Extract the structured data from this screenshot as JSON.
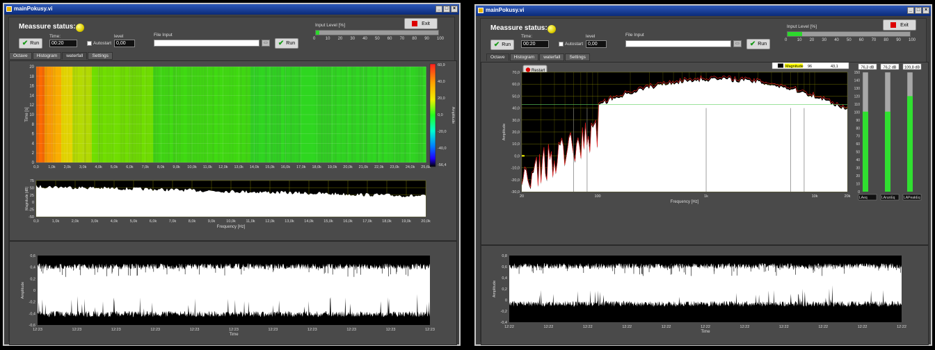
{
  "left_window": {
    "title": "mainPokusy.vi",
    "status_label": "Meassure status:",
    "run_label": "Run",
    "time_label": "Time:",
    "time_value": "00:20",
    "autostart_label": "Autostart",
    "level_label": "level",
    "level_value": "0,00",
    "file_input_label": "File Input",
    "file_input_value": "",
    "run2_label": "Run",
    "input_level_label": "Input Level [%]",
    "input_level_ticks": [
      "0",
      "10",
      "20",
      "30",
      "40",
      "50",
      "60",
      "70",
      "80",
      "90",
      "100"
    ],
    "input_level_percent": 3,
    "exit_label": "Exit",
    "tabs": [
      "Octave",
      "Histogram",
      "waterfall",
      "Settings"
    ],
    "active_tab": 2,
    "waterfall": {
      "y_label": "Time [s]",
      "y_ticks": [
        "20",
        "18",
        "16",
        "14",
        "12",
        "10",
        "8",
        "6",
        "4",
        "2",
        "0"
      ],
      "x_ticks": [
        "0,0",
        "1,0k",
        "2,0k",
        "3,0k",
        "4,0k",
        "5,0k",
        "6,0k",
        "7,0k",
        "8,0k",
        "9,0k",
        "10,0k",
        "11,0k",
        "12,0k",
        "13,0k",
        "14,0k",
        "15,0k",
        "16,0k",
        "17,0k",
        "18,0k",
        "19,0k",
        "20,0k",
        "21,0k",
        "22,0k",
        "23,0k",
        "24,0k",
        "25,6k"
      ],
      "colorbar_ticks": [
        "60,9",
        "40,0",
        "20,0",
        "0,0",
        "-20,0",
        "-40,0",
        "-56,4"
      ],
      "colorbar_label": "Amplitude"
    },
    "spectrum": {
      "y_label": "Magnitude [dB]",
      "y_ticks": [
        "75",
        "50",
        "25",
        "0",
        "-25",
        "-50"
      ],
      "x_ticks": [
        "0,0",
        "1,0k",
        "2,0k",
        "3,0k",
        "4,0k",
        "5,0k",
        "6,0k",
        "7,0k",
        "8,0k",
        "9,0k",
        "10,0k",
        "11,0k",
        "12,0k",
        "13,0k",
        "14,0k",
        "15,0k",
        "16,0k",
        "17,0k",
        "18,0k",
        "19,0k",
        "20,0k"
      ],
      "x_label": "Frequency [Hz]"
    },
    "time_plot": {
      "y_label": "Amplitude",
      "y_ticks": [
        "0,6",
        "0,4",
        "0,2",
        "0",
        "-0,2",
        "-0,4",
        "-0,6"
      ],
      "x_ticks": [
        "12:23",
        "12:23",
        "12:23",
        "12:23",
        "12:23",
        "12:23",
        "12:23",
        "12:23",
        "12:23",
        "12:23",
        "12:23"
      ],
      "x_label": "Time"
    }
  },
  "right_window": {
    "title": "mainPokusy.vi",
    "status_label": "Meassure status:",
    "run_label": "Run",
    "time_label": "Time:",
    "time_value": "00:20",
    "autostart_label": "Autostart",
    "level_label": "level",
    "level_value": "0,00",
    "file_input_label": "File Input",
    "file_input_value": "",
    "run2_label": "Run",
    "input_level_label": "Input Level [%]",
    "input_level_ticks": [
      "0",
      "10",
      "20",
      "30",
      "40",
      "50",
      "60",
      "70",
      "80",
      "90",
      "100"
    ],
    "input_level_percent": 12,
    "exit_label": "Exit",
    "tabs": [
      "Octave",
      "Histogram",
      "waterfall",
      "Settings"
    ],
    "active_tab": 0,
    "restart_label": "Restart",
    "legend": {
      "name": "Magnitude",
      "x": "96",
      "y": "43,1"
    },
    "octave": {
      "y_label": "Amplitude",
      "y_ticks": [
        "70,0",
        "60,0",
        "50,0",
        "40,0",
        "30,0",
        "20,0",
        "10,0",
        "0,0",
        "-10,0",
        "-20,0",
        "-30,0"
      ],
      "x_ticks": [
        "20",
        "100",
        "1k",
        "10k",
        "20k"
      ],
      "x_label": "Frequency [Hz]"
    },
    "meters": [
      {
        "value_label": "76,3 dB",
        "name": "LAeq",
        "fill_percent": 67
      },
      {
        "value_label": "76,2 dB",
        "name": "LArunEq",
        "fill_percent": 67
      },
      {
        "value_label": "109,8 dB",
        "name": "LAPeakEq",
        "fill_percent": 80
      }
    ],
    "meter_ticks": [
      "150",
      "140",
      "130",
      "120",
      "110",
      "100",
      "90",
      "80",
      "70",
      "60",
      "50",
      "40",
      "30",
      "20",
      "10",
      "0"
    ],
    "time_plot": {
      "y_label": "Amplitude",
      "y_ticks": [
        "0,8",
        "0,6",
        "0,4",
        "0,2",
        "0",
        "-0,2",
        "-0,4"
      ],
      "x_ticks": [
        "12:22",
        "12:22",
        "12:22",
        "12:22",
        "12:22",
        "12:22",
        "12:22",
        "12:22",
        "12:22",
        "12:22",
        "12:22"
      ],
      "x_label": "Time"
    }
  }
}
